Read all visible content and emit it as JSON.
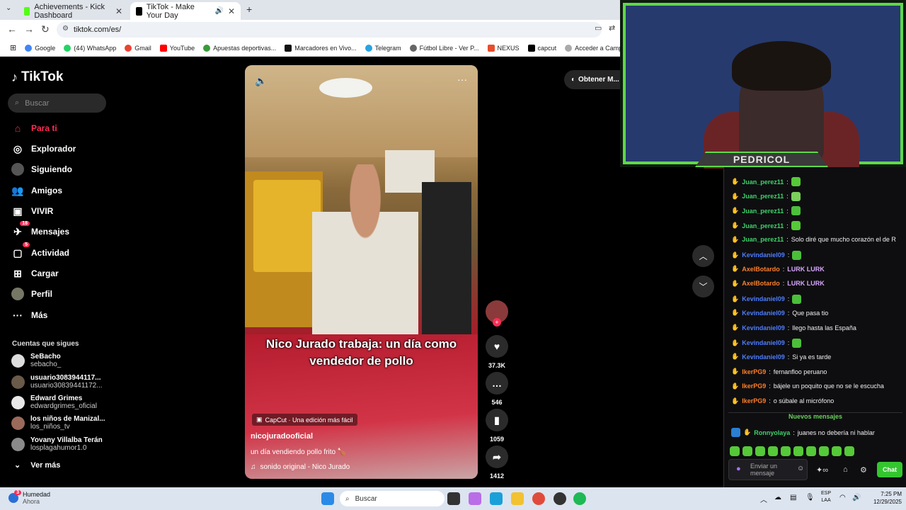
{
  "browser": {
    "tabs": [
      {
        "label": "Achievements - Kick Dashboard",
        "active": false
      },
      {
        "label": "TikTok - Make Your Day",
        "active": true
      }
    ],
    "url": "tiktok.com/es/",
    "bookmarks": [
      "Google",
      "(44) WhatsApp",
      "Gmail",
      "YouTube",
      "Apuestas deportivas...",
      "Marcadores en Vivo...",
      "Telegram",
      "Fútbol Libre - Ver P...",
      "NEXUS",
      "capcut",
      "Acceder a Campus..."
    ]
  },
  "tiktok": {
    "logo": "TikTok",
    "search_placeholder": "Buscar",
    "nav": [
      {
        "label": "Para ti",
        "icon": "home-icon",
        "active": true
      },
      {
        "label": "Explorador",
        "icon": "compass-icon"
      },
      {
        "label": "Siguiendo",
        "icon": "following-avatar-icon"
      },
      {
        "label": "Amigos",
        "icon": "friends-icon"
      },
      {
        "label": "VIVIR",
        "icon": "live-icon"
      },
      {
        "label": "Mensajes",
        "icon": "messages-icon",
        "badge": "18"
      },
      {
        "label": "Actividad",
        "icon": "activity-icon",
        "badge": "5"
      },
      {
        "label": "Cargar",
        "icon": "upload-icon"
      },
      {
        "label": "Perfil",
        "icon": "profile-icon"
      },
      {
        "label": "Más",
        "icon": "more-icon"
      }
    ],
    "following_header": "Cuentas que sigues",
    "following": [
      {
        "name": "SeBacho",
        "handle": "sebacho_"
      },
      {
        "name": "usuario3083944117...",
        "handle": "usuario30839441172..."
      },
      {
        "name": "Edward Grimes",
        "handle": "edwardgrimes_oficial"
      },
      {
        "name": "los niños de Manizal...",
        "handle": "los_niños_tv"
      },
      {
        "name": "Yovany Villalba Terán",
        "handle": "losplagahumor1.0"
      }
    ],
    "see_more": "Ver más",
    "video": {
      "caption": "Nico Jurado trabaja: un día como vendedor de pollo",
      "capcut_badge": "CapCut · Una edición más fácil",
      "author": "nicojuradooficial",
      "description": "un día vendiendo pollo frito 🍗",
      "sound": "sonido original - Nico Jurado"
    },
    "actions": {
      "likes": "37.3K",
      "comments": "546",
      "saves": "1059",
      "shares": "1412"
    },
    "get_app": "Obtener M..."
  },
  "stream": {
    "streamer_name": "PEDRICOL",
    "chat": [
      {
        "user": "Juan_perez11",
        "color": "#3fd36a",
        "text": "",
        "emote": true
      },
      {
        "user": "Juan_perez11",
        "color": "#3fd36a",
        "text": "",
        "emote": true
      },
      {
        "user": "Juan_perez11",
        "color": "#3fd36a",
        "text": "",
        "emote": true
      },
      {
        "user": "Juan_perez11",
        "color": "#3fd36a",
        "text": "",
        "emote": true
      },
      {
        "user": "Juan_perez11",
        "color": "#3fd36a",
        "text": "Solo diré que mucho corazón el de R"
      },
      {
        "user": "Kevindaniel09",
        "color": "#4d7dff",
        "text": "",
        "emote": true
      },
      {
        "user": "AxelBotardo",
        "color": "#ff7f2a",
        "text": "LURK LURK"
      },
      {
        "user": "AxelBotardo",
        "color": "#ff7f2a",
        "text": "LURK LURK"
      },
      {
        "user": "Kevindaniel09",
        "color": "#4d7dff",
        "text": "",
        "emote": true
      },
      {
        "user": "Kevindaniel09",
        "color": "#4d7dff",
        "text": "Que pasa tio"
      },
      {
        "user": "Kevindaniel09",
        "color": "#4d7dff",
        "text": "llego hasta las España"
      },
      {
        "user": "Kevindaniel09",
        "color": "#4d7dff",
        "text": "",
        "emote": true
      },
      {
        "user": "Kevindaniel09",
        "color": "#4d7dff",
        "text": "Si ya es tarde"
      },
      {
        "user": "IkerPG9",
        "color": "#ff7f2a",
        "text": "fernanfloo peruano"
      },
      {
        "user": "IkerPG9",
        "color": "#ff7f2a",
        "text": "bájele un poquito que no se le escucha"
      },
      {
        "user": "IkerPG9",
        "color": "#ff7f2a",
        "text": "o súbale al micrófono"
      }
    ],
    "new_messages_label": "Nuevos mensajes",
    "last_message": {
      "user": "Ronnyolaya",
      "color": "#3fd36a",
      "text": "juanes no debería ni hablar"
    },
    "input_placeholder": "Enviar un mensaje",
    "chat_button": "Chat"
  },
  "taskbar": {
    "weather_title": "Humedad",
    "weather_sub": "Ahora",
    "notification_badge": "3",
    "search_placeholder": "Buscar",
    "lang1": "ESP",
    "lang2": "LAA",
    "time": "7:25 PM",
    "date": "12/29/2025"
  }
}
